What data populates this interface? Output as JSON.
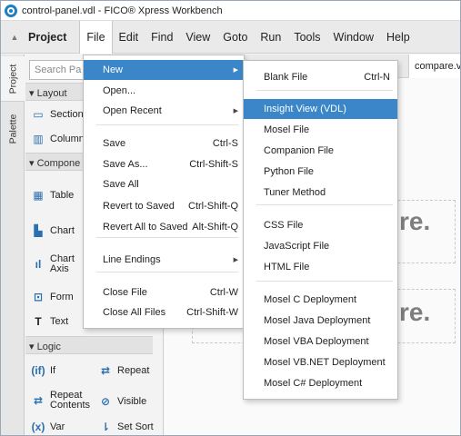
{
  "window": {
    "title": "control-panel.vdl - FICO® Xpress Workbench"
  },
  "menubar": {
    "collapse_icon": "▲",
    "project_title": "Project",
    "items": [
      "File",
      "Edit",
      "Find",
      "View",
      "Goto",
      "Run",
      "Tools",
      "Window",
      "Help"
    ]
  },
  "side_tabs": [
    "Project",
    "Palette"
  ],
  "palette": {
    "search_placeholder": "Search Pa",
    "layout_header": "▾ Layout",
    "layout_items": [
      "Section",
      "Column"
    ],
    "components_header": "▾ Compone",
    "component_items": [
      "Table",
      "Chart",
      "Chart Axis",
      "Form",
      "Text"
    ],
    "logic_header": "▾ Logic",
    "logic_items": [
      "If",
      "Repeat",
      "Repeat Contents",
      "Visible",
      "Var",
      "Set Sort"
    ]
  },
  "workspace": {
    "tab_label": "compare.vd",
    "faded_text_1": "re.",
    "faded_text_2": "re."
  },
  "file_menu": {
    "items": [
      {
        "label": "New",
        "shortcut": "",
        "submenu": true,
        "highlighted": true
      },
      {
        "label": "Open...",
        "shortcut": "",
        "submenu": false
      },
      {
        "label": "Open Recent",
        "shortcut": "",
        "submenu": true
      },
      {
        "label": "Save",
        "shortcut": "Ctrl-S",
        "submenu": false
      },
      {
        "label": "Save As...",
        "shortcut": "Ctrl-Shift-S",
        "submenu": false
      },
      {
        "label": "Save All",
        "shortcut": "",
        "submenu": false
      },
      {
        "label": "Revert to Saved",
        "shortcut": "Ctrl-Shift-Q",
        "submenu": false
      },
      {
        "label": "Revert All to Saved",
        "shortcut": "Alt-Shift-Q",
        "submenu": false
      },
      {
        "label": "Line Endings",
        "shortcut": "",
        "submenu": true
      },
      {
        "label": "Close File",
        "shortcut": "Ctrl-W",
        "submenu": false
      },
      {
        "label": "Close All Files",
        "shortcut": "Ctrl-Shift-W",
        "submenu": false
      }
    ]
  },
  "new_submenu": {
    "items": [
      {
        "label": "Blank File",
        "shortcut": "Ctrl-N"
      },
      {
        "label": "Insight View (VDL)",
        "shortcut": "",
        "highlighted": true
      },
      {
        "label": "Mosel File",
        "shortcut": ""
      },
      {
        "label": "Companion File",
        "shortcut": ""
      },
      {
        "label": "Python File",
        "shortcut": ""
      },
      {
        "label": "Tuner Method",
        "shortcut": ""
      },
      {
        "label": "CSS File",
        "shortcut": ""
      },
      {
        "label": "JavaScript File",
        "shortcut": ""
      },
      {
        "label": "HTML File",
        "shortcut": ""
      },
      {
        "label": "Mosel C Deployment",
        "shortcut": ""
      },
      {
        "label": "Mosel Java Deployment",
        "shortcut": ""
      },
      {
        "label": "Mosel VBA Deployment",
        "shortcut": ""
      },
      {
        "label": "Mosel VB.NET Deployment",
        "shortcut": ""
      },
      {
        "label": "Mosel C# Deployment",
        "shortcut": ""
      }
    ]
  },
  "colors": {
    "highlight": "#3a86c8",
    "icon_blue": "#2a6fb0"
  },
  "icons": {
    "submenu_arrow": "▶"
  }
}
